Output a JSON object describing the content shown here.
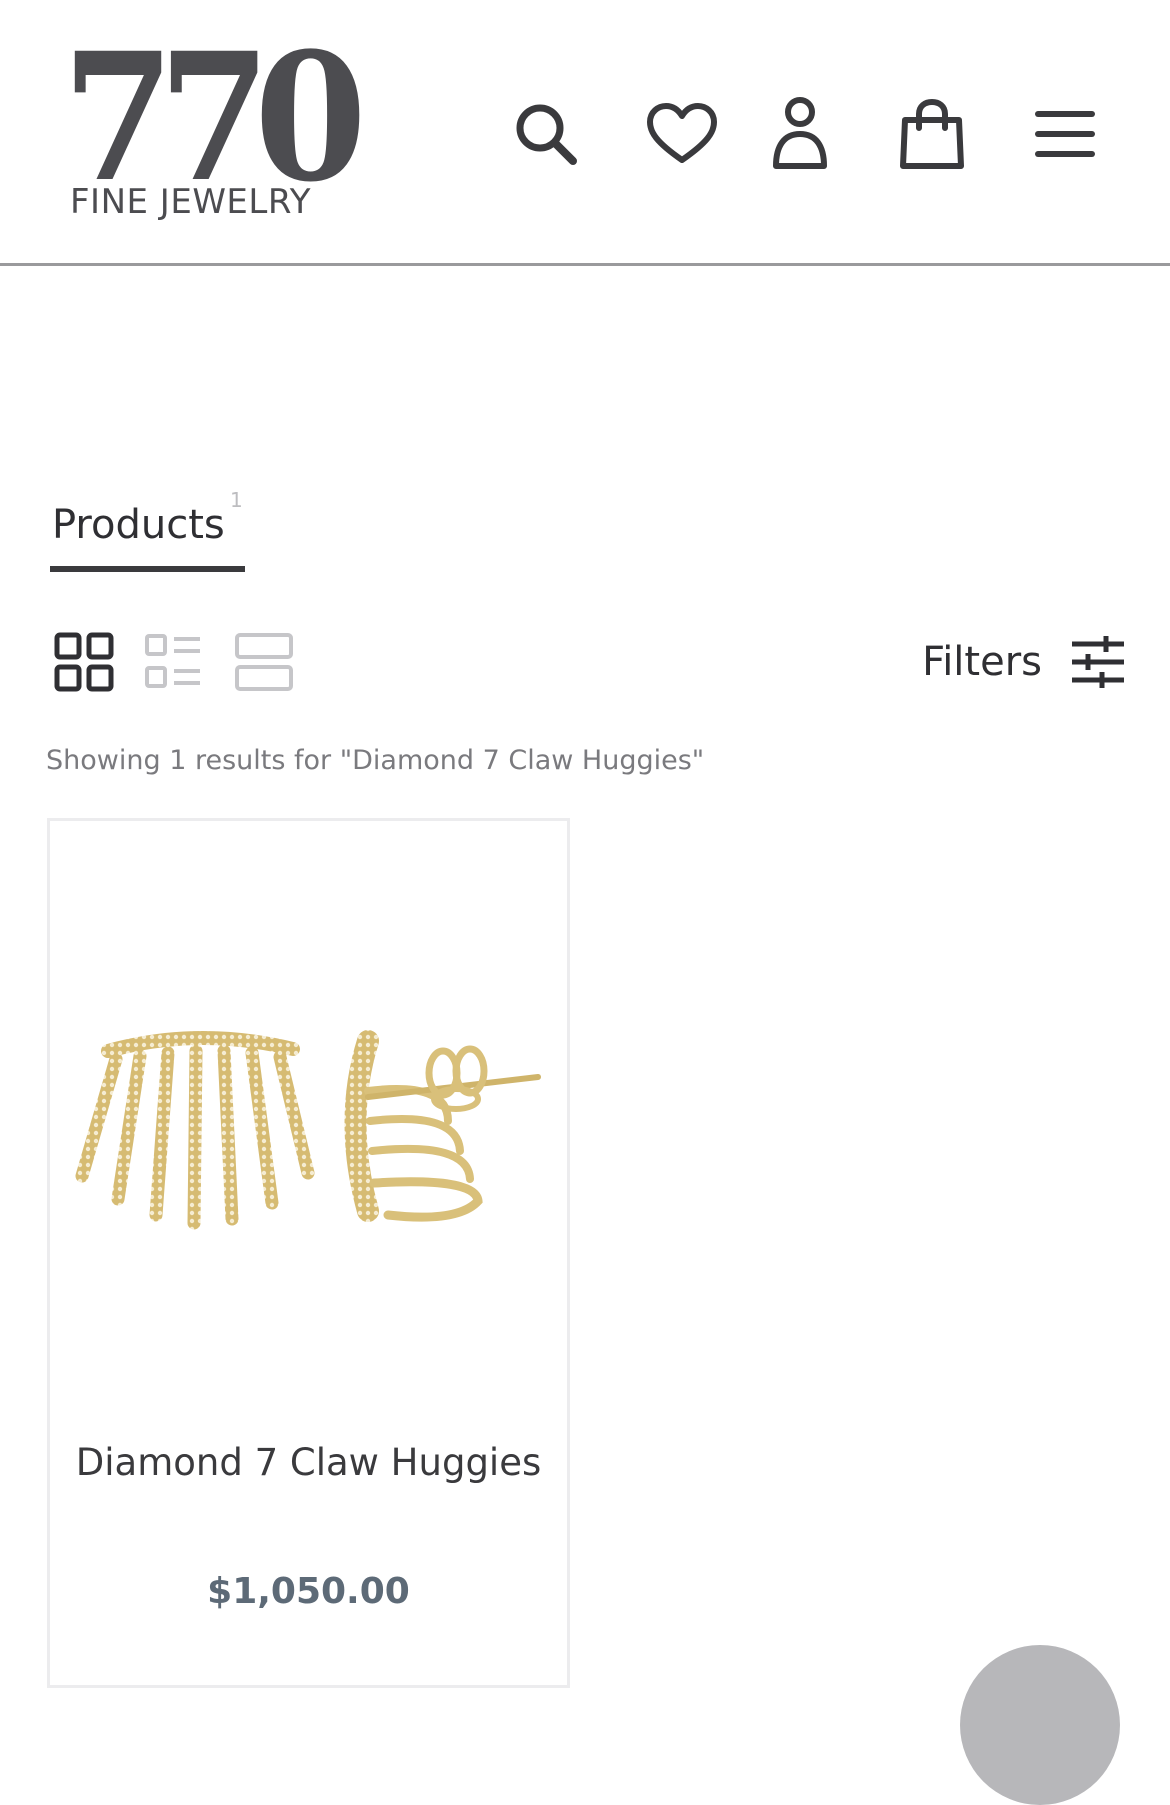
{
  "header": {
    "logo_number": "770",
    "logo_subtitle": "FINE JEWELRY",
    "icons": [
      "search-icon",
      "heart-icon",
      "user-icon",
      "shopping-bag-icon",
      "menu-icon"
    ]
  },
  "tabs": [
    {
      "label": "Products",
      "count": "1",
      "active": true
    }
  ],
  "view_toggle": {
    "options": [
      "grid-view-icon",
      "list-view-icon",
      "wide-view-icon"
    ],
    "selected": "grid-view-icon"
  },
  "filters": {
    "label": "Filters",
    "icon": "sliders-icon"
  },
  "results_text": "Showing 1 results for \"Diamond 7 Claw Huggies\"",
  "products": [
    {
      "title": "Diamond 7 Claw Huggies",
      "price": "$1,050.00",
      "image": "gold-diamond-claw-earrings"
    }
  ],
  "colors": {
    "text": "#3a3a3d",
    "muted": "#7a7a7e",
    "price": "#5d6a77",
    "gold": "#d9c07a",
    "divider": "#9a9a9c"
  }
}
